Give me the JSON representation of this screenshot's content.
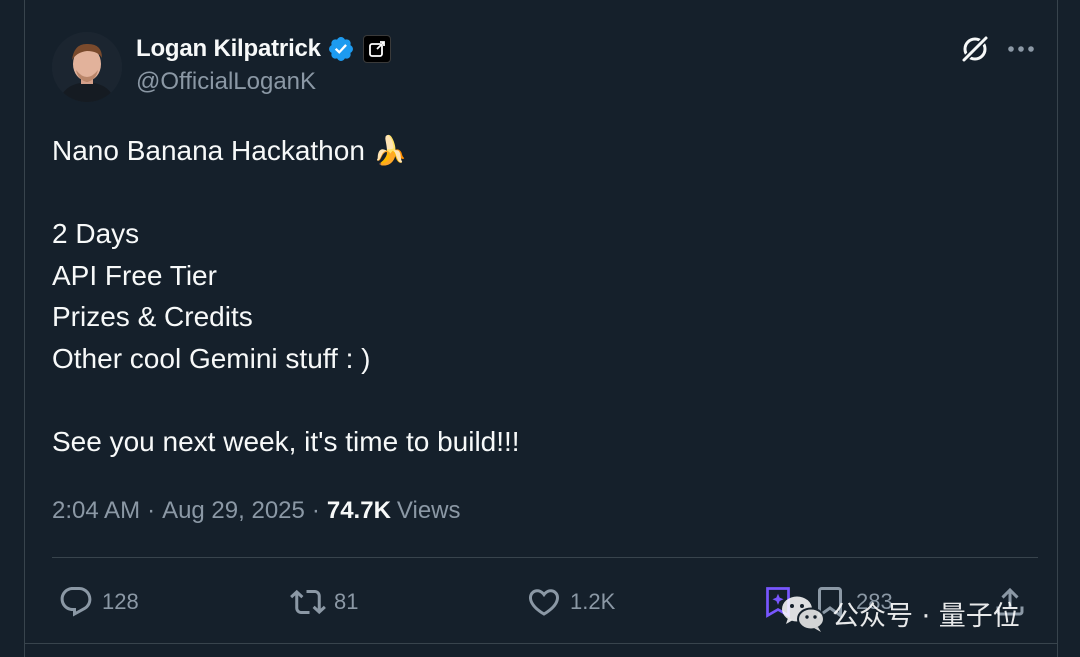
{
  "author": {
    "display_name": "Logan Kilpatrick",
    "handle": "@OfficialLoganK",
    "verified_icon": "verified-badge-icon",
    "affiliation_icon": "affiliate-badge-icon"
  },
  "tweet": {
    "lines": [
      "Nano Banana Hackathon 🍌",
      "",
      "2 Days",
      "API Free Tier",
      "Prizes & Credits",
      "Other cool Gemini stuff : )",
      "",
      "See you next week, it's time to build!!!"
    ],
    "time": "2:04 AM",
    "date": "Aug 29, 2025",
    "separator": "·",
    "views_count": "74.7K",
    "views_label": "Views"
  },
  "actions": {
    "replies": "128",
    "reposts": "81",
    "likes": "1.2K",
    "bookmarks": "283"
  },
  "watermark": {
    "text": "公众号 · 量子位"
  },
  "colors": {
    "background": "#15202b",
    "text_primary": "#f7f9f9",
    "text_secondary": "#8b98a5",
    "verified_blue": "#1d9bf0",
    "grok_purple": "#7856ff"
  }
}
